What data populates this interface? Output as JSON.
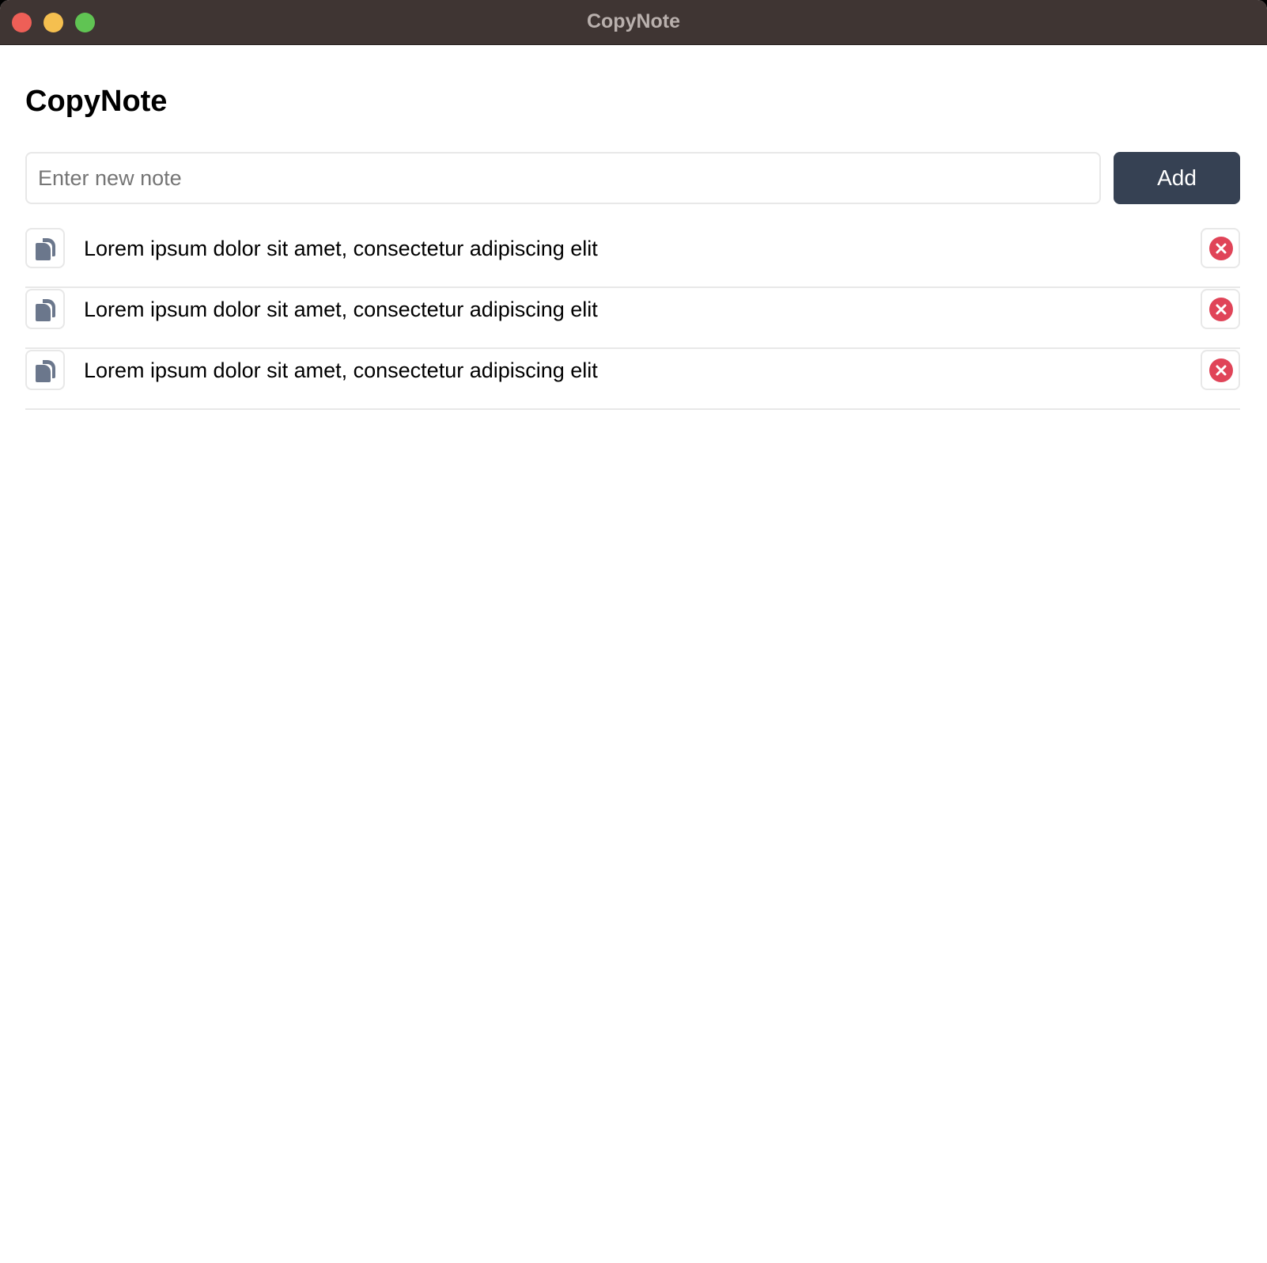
{
  "window": {
    "title": "CopyNote"
  },
  "header": {
    "title": "CopyNote"
  },
  "composer": {
    "placeholder": "Enter new note",
    "value": "",
    "add_label": "Add"
  },
  "notes": [
    {
      "text": "Lorem ipsum dolor sit amet, consectetur adipiscing elit"
    },
    {
      "text": "Lorem ipsum dolor sit amet, consectetur adipiscing elit"
    },
    {
      "text": "Lorem ipsum dolor sit amet, consectetur adipiscing elit"
    }
  ],
  "icons": {
    "copy": "copy-icon",
    "delete": "close-circle-icon"
  },
  "colors": {
    "titlebar": "#3f3533",
    "add_button": "#364153",
    "copy_icon": "#6b778c",
    "delete_icon": "#e04458",
    "traffic_close": "#ee5f57",
    "traffic_minimize": "#f5bf4f",
    "traffic_maximize": "#60c453"
  }
}
